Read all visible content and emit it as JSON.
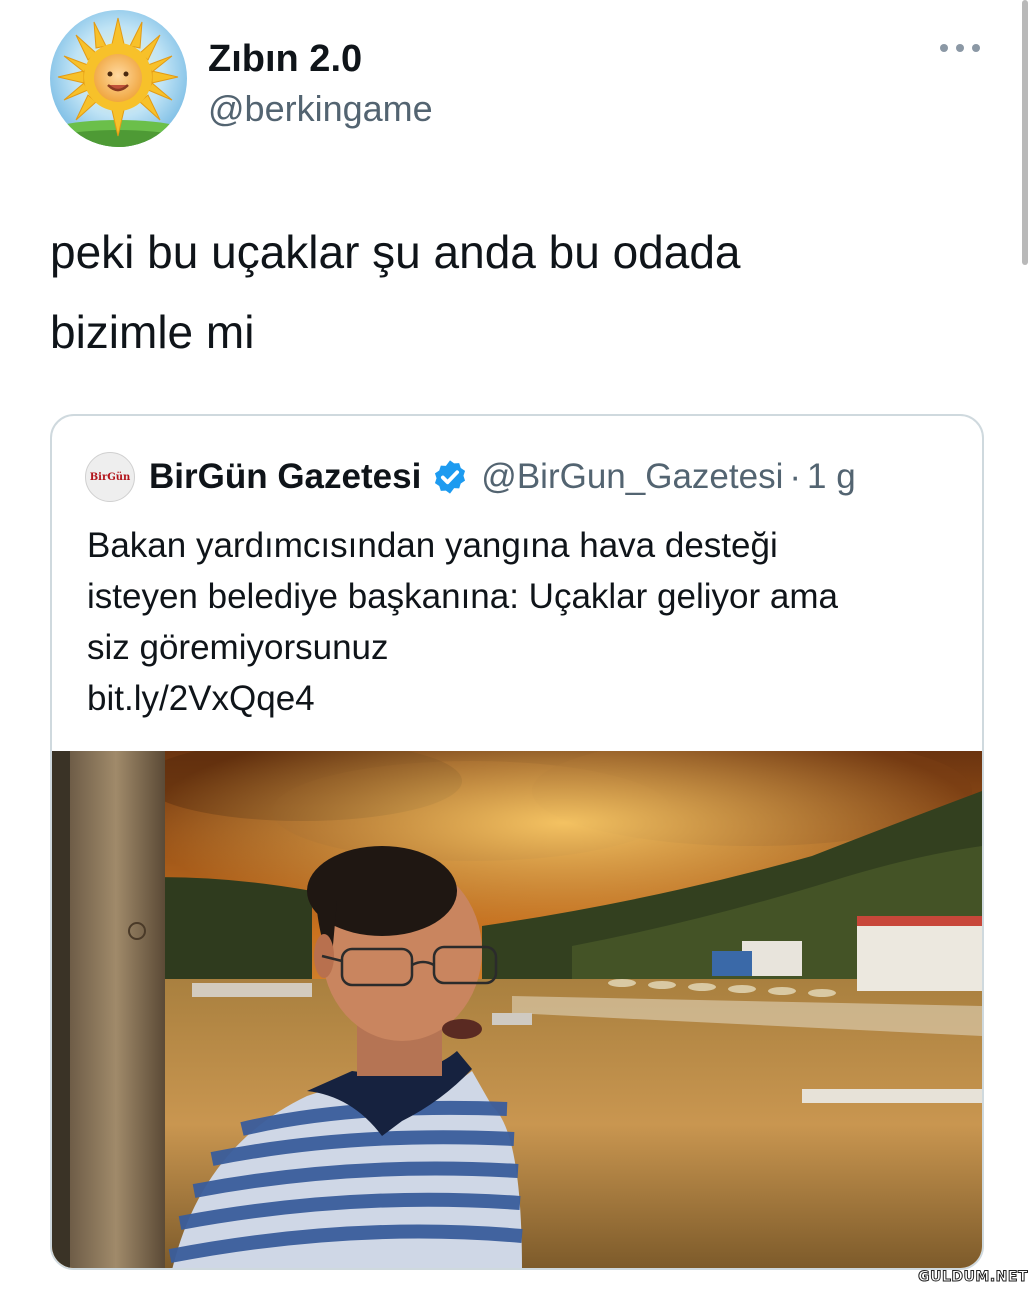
{
  "tweet": {
    "display_name": "Zıbın 2.0",
    "handle": "@berkingame",
    "text_line1": "peki bu uçaklar şu anda bu odada",
    "text_line2": "bizimle mi",
    "avatar_icon": "sun-baby-avatar",
    "more_icon": "more-dots-icon"
  },
  "quoted_tweet": {
    "logo_text": "BirGün",
    "display_name": "BirGün Gazetesi",
    "verified_icon": "verified-badge-icon",
    "handle": "@BirGun_Gazetesi",
    "separator": "·",
    "time": "1 g",
    "text_line1": "Bakan yardımcısından yangına hava desteği",
    "text_line2": "isteyen belediye başkanına: Uçaklar geliyor ama",
    "text_line3": "siz göremiyorsunuz",
    "link": "bit.ly/2VxQqe4",
    "media_icon": "wildfire-photo"
  },
  "watermark": "GULDUM.NET",
  "colors": {
    "text": "#0f1419",
    "secondary": "#536471",
    "verified": "#1d9bf0",
    "border": "#cfd9de"
  }
}
